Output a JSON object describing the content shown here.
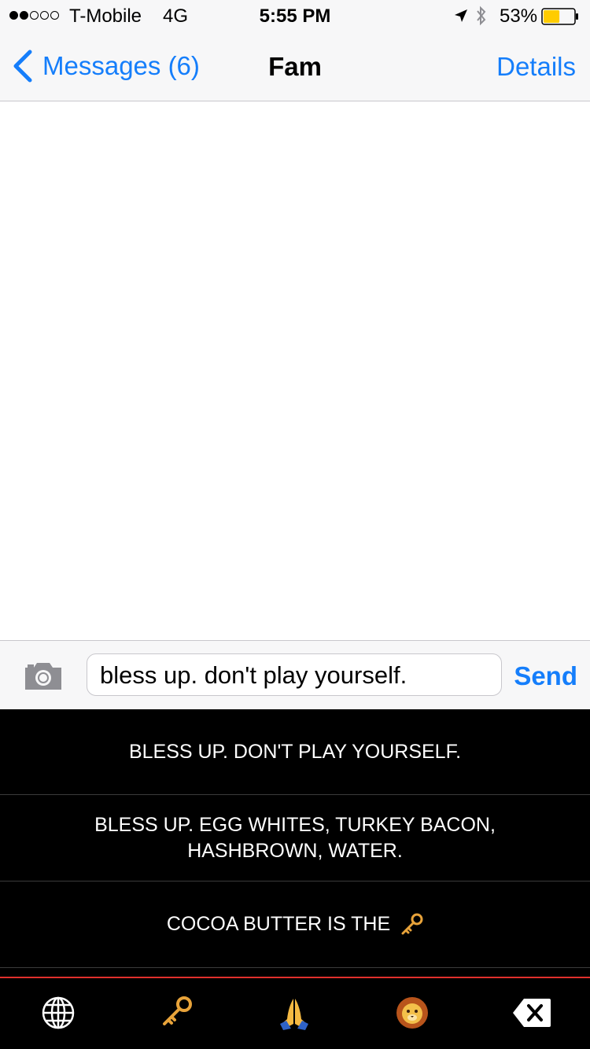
{
  "status_bar": {
    "signal_dots_filled": 2,
    "signal_dots_total": 5,
    "carrier": "T-Mobile",
    "network": "4G",
    "time": "5:55 PM",
    "battery_percent": "53%",
    "battery_level": 0.53,
    "battery_color": "#ffcc00",
    "icons": [
      "location-icon",
      "bluetooth-icon",
      "battery-icon"
    ]
  },
  "nav": {
    "back_label": "Messages (6)",
    "title": "Fam",
    "details_label": "Details",
    "accent_color": "#157efb"
  },
  "composer": {
    "input_value": "bless up. don't play yourself.",
    "send_label": "Send",
    "camera_icon": "camera-icon"
  },
  "keyboard": {
    "suggestions": [
      {
        "text": "BLESS UP. DON'T PLAY YOURSELF."
      },
      {
        "text": "BLESS UP. EGG WHITES, TURKEY BACON, HASHBROWN, WATER."
      },
      {
        "text": "COCOA BUTTER IS THE",
        "trailing_emoji": "key-emoji"
      }
    ],
    "bottom_bar": [
      {
        "name": "globe-icon"
      },
      {
        "name": "key-emoji"
      },
      {
        "name": "folded-hands-emoji"
      },
      {
        "name": "lion-emoji"
      },
      {
        "name": "delete-icon"
      }
    ],
    "divider_color": "#e0302c"
  }
}
